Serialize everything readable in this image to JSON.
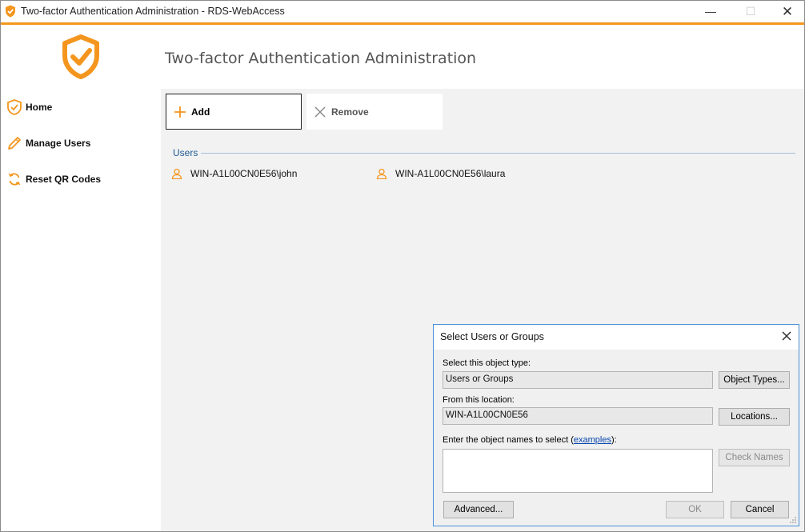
{
  "window": {
    "title": "Two-factor Authentication Administration - RDS-WebAccess",
    "minimize": "—",
    "maximize": "☐",
    "close": "✕"
  },
  "colors": {
    "accent": "#f4961e",
    "link": "#0645ad",
    "section": "#1e5a96"
  },
  "app": {
    "heading": "Two-factor Authentication Administration"
  },
  "sidebar": {
    "items": [
      {
        "label": "Home",
        "icon": "shield-check-icon"
      },
      {
        "label": "Manage Users",
        "icon": "pencil-icon"
      },
      {
        "label": "Reset QR Codes",
        "icon": "refresh-icon"
      }
    ]
  },
  "toolbar": {
    "add_label": "Add",
    "remove_label": "Remove"
  },
  "users_section": {
    "label": "Users",
    "users": [
      "WIN-A1L00CN0E56\\john",
      "WIN-A1L00CN0E56\\laura"
    ]
  },
  "dialog": {
    "title": "Select Users or Groups",
    "object_type_label": "Select this object type:",
    "object_type_value": "Users or Groups",
    "object_types_button": "Object Types...",
    "location_label": "From this location:",
    "location_value": "WIN-A1L00CN0E56",
    "locations_button": "Locations...",
    "names_label_prefix": "Enter the object names to select (",
    "names_label_link": "examples",
    "names_label_suffix": "):",
    "names_value": "",
    "check_names_button": "Check Names",
    "advanced_button": "Advanced...",
    "ok_button": "OK",
    "cancel_button": "Cancel"
  }
}
